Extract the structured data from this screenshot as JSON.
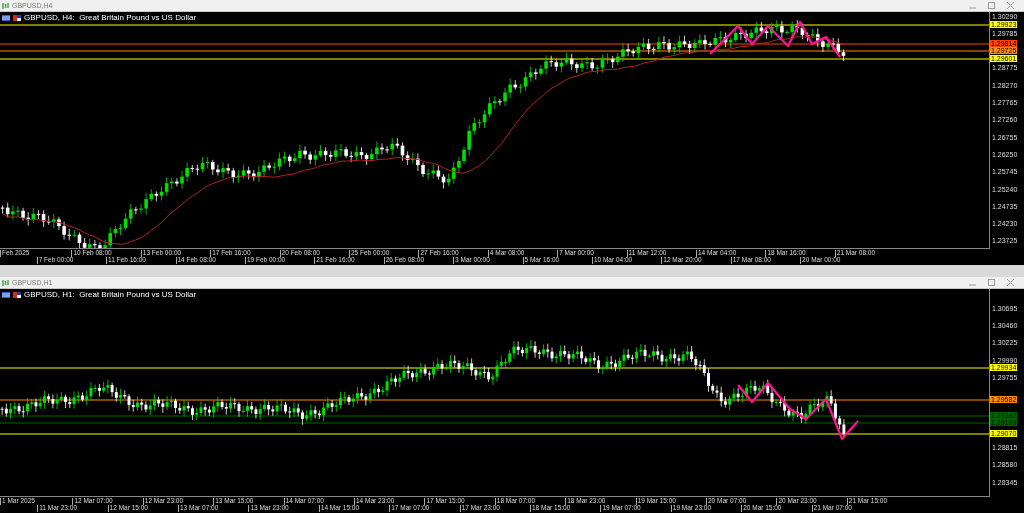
{
  "charts": [
    {
      "window_title": "GBPUSD,H4",
      "header": "GBPUSD, H4:  Great Britain Pound vs US Dollar",
      "price_axis": [
        "1.30290",
        "1.29785",
        "1.28775",
        "1.28270",
        "1.27765",
        "1.27260",
        "1.26755",
        "1.26250",
        "1.25745",
        "1.25240",
        "1.24735",
        "1.24230",
        "1.23725"
      ],
      "price_tags": [
        {
          "text": "1.29923",
          "color": "#ffff00"
        },
        {
          "text": "1.29814",
          "color": "#ff4500"
        },
        {
          "text": "1.29725",
          "color": "#ff8c00"
        },
        {
          "text": "1.29601",
          "color": "#ffff00"
        }
      ],
      "time_axis": [
        "Feb 2025",
        "7 Feb 00:00",
        "10 Feb 08:00",
        "11 Feb 16:00",
        "13 Feb 00:00",
        "14 Feb 08:00",
        "17 Feb 16:00",
        "19 Feb 00:00",
        "20 Feb 08:00",
        "21 Feb 16:00",
        "25 Feb 00:00",
        "26 Feb 08:00",
        "27 Feb 16:00",
        "3 Mar 00:00",
        "4 Mar 08:00",
        "5 Mar 16:00",
        "7 Mar 00:00",
        "10 Mar 04:00",
        "11 Mar 12:00",
        "12 Mar 20:00",
        "14 Mar 04:00",
        "17 Mar 08:00",
        "18 Mar 16:00",
        "20 Mar 00:00",
        "21 Mar 08:00"
      ]
    },
    {
      "window_title": "GBPUSD,H1",
      "header": "GBPUSD, H1:  Great Britain Pound vs US Dollar",
      "price_axis": [
        "1.30695",
        "1.30460",
        "1.30225",
        "1.29990",
        "1.29755",
        "1.28815",
        "1.28580",
        "1.28345"
      ],
      "price_tags": [
        {
          "text": "1.29934",
          "color": "#ffff00"
        },
        {
          "text": "1.29582",
          "color": "#ff8c00"
        },
        {
          "text": "1.29282",
          "color": "#006400"
        },
        {
          "text": "1.29189",
          "color": "#006400"
        },
        {
          "text": "1.29070",
          "color": "#ffff00"
        }
      ],
      "time_axis": [
        "1 Mar 2025",
        "11 Mar 23:00",
        "12 Mar 07:00",
        "12 Mar 15:00",
        "12 Mar 23:00",
        "13 Mar 07:00",
        "13 Mar 15:00",
        "13 Mar 23:00",
        "14 Mar 07:00",
        "14 Mar 15:00",
        "14 Mar 23:00",
        "17 Mar 07:00",
        "17 Mar 15:00",
        "17 Mar 23:00",
        "18 Mar 07:00",
        "18 Mar 15:00",
        "18 Mar 23:00",
        "19 Mar 07:00",
        "19 Mar 15:00",
        "19 Mar 23:00",
        "20 Mar 07:00",
        "20 Mar 15:00",
        "20 Mar 23:00",
        "21 Mar 07:00",
        "21 Mar 15:00"
      ]
    }
  ]
}
